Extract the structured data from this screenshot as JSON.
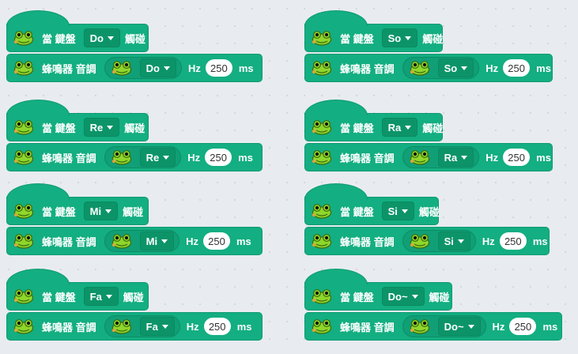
{
  "labels": {
    "when_key": "當 鍵盤",
    "touched": "觸碰",
    "buzzer": "蜂鳴器 音調",
    "hz": "Hz",
    "ms": "ms"
  },
  "icons": {
    "frog": "frog-sprite-icon"
  },
  "colors": {
    "block": "#13ae81",
    "dropdown": "#0c9468",
    "frog": "#8fd62a"
  },
  "stacks": [
    {
      "key": "Do",
      "note": "Do",
      "duration": "250"
    },
    {
      "key": "Re",
      "note": "Re",
      "duration": "250"
    },
    {
      "key": "Mi",
      "note": "Mi",
      "duration": "250"
    },
    {
      "key": "Fa",
      "note": "Fa",
      "duration": "250"
    },
    {
      "key": "So",
      "note": "So",
      "duration": "250"
    },
    {
      "key": "Ra",
      "note": "Ra",
      "duration": "250"
    },
    {
      "key": "Si",
      "note": "Si",
      "duration": "250"
    },
    {
      "key": "Do~",
      "note": "Do~",
      "duration": "250"
    }
  ]
}
